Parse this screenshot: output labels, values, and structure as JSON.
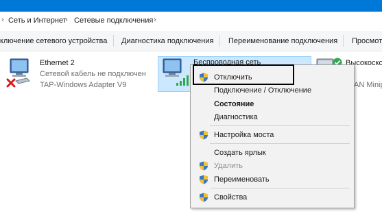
{
  "address_bar": {
    "crumbs": [
      "Сеть и Интернет",
      "Сетевые подключения"
    ]
  },
  "toolbar": {
    "buttons": [
      "ключение сетевого устройства",
      "Диагностика подключения",
      "Переименование подключения",
      "Просмот"
    ]
  },
  "connections": [
    {
      "name": "Ethernet 2",
      "status": "Сетевой кабель не подключен",
      "adapter": "TAP-Windows Adapter V9"
    },
    {
      "name": "Беспроводная сеть",
      "status": "",
      "adapter": ""
    },
    {
      "name": "Высокоско",
      "status": "",
      "adapter": "AN Minip"
    }
  ],
  "context_menu": {
    "items": [
      {
        "label": "Отключить",
        "shield": true,
        "bold": false,
        "disabled": false
      },
      {
        "label": "Подключение / Отключение",
        "shield": false,
        "bold": false,
        "disabled": false
      },
      {
        "label": "Состояние",
        "shield": false,
        "bold": true,
        "disabled": false
      },
      {
        "label": "Диагностика",
        "shield": false,
        "bold": false,
        "disabled": false
      },
      {
        "label": "Настройка моста",
        "shield": true,
        "bold": false,
        "disabled": false
      },
      {
        "label": "Создать ярлык",
        "shield": false,
        "bold": false,
        "disabled": false
      },
      {
        "label": "Удалить",
        "shield": true,
        "bold": false,
        "disabled": true
      },
      {
        "label": "Переименовать",
        "shield": true,
        "bold": false,
        "disabled": false
      },
      {
        "label": "Свойства",
        "shield": true,
        "bold": false,
        "disabled": false
      }
    ]
  },
  "colors": {
    "titlebar": "#0078d7",
    "selection": "#cce8ff",
    "error_red": "#d4181b",
    "ok_green": "#2fa84f"
  },
  "icons": [
    "chevron-right-icon",
    "network-adapter-icon",
    "disconnected-x-icon",
    "wifi-signal-icon",
    "connected-check-icon",
    "shield-icon"
  ]
}
